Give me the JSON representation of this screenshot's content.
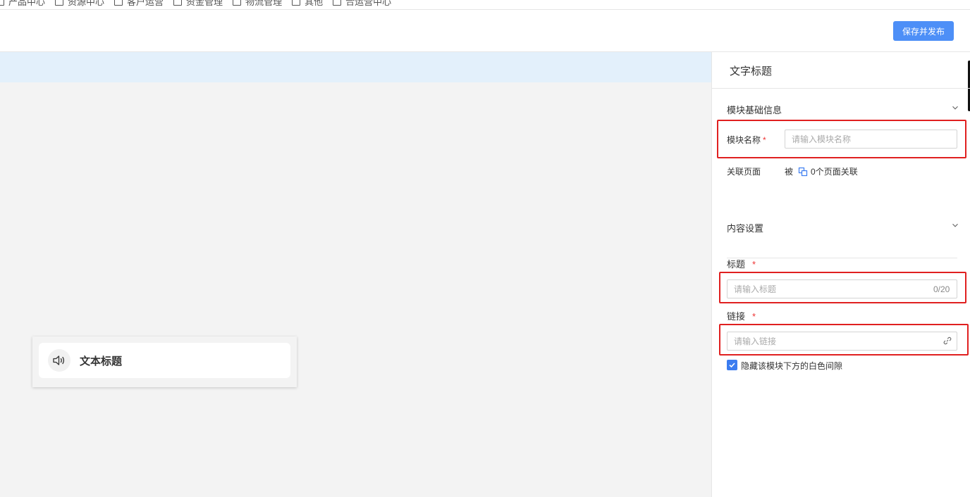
{
  "topnav": {
    "items": [
      "产品中心",
      "资源中心",
      "客户运营",
      "资金管理",
      "物流管理",
      "其他",
      "合运营中心"
    ]
  },
  "header": {
    "publish_button": "保存并发布"
  },
  "canvas": {
    "module_title": "文本标题",
    "module_icon": "speaker-icon"
  },
  "panel": {
    "title": "文字标题",
    "basic_section": {
      "heading": "模块基础信息",
      "name_label": "模块名称",
      "name_placeholder": "请输入模块名称",
      "assoc_label": "关联页面",
      "assoc_prefix": "被",
      "assoc_text": "0个页面关联"
    },
    "content_section": {
      "heading": "内容设置",
      "title_label": "标题",
      "title_placeholder": "请输入标题",
      "title_counter": "0/20",
      "link_label": "链接",
      "link_placeholder": "请输入链接",
      "hide_gap_label": "隐藏该模块下方的白色间隙",
      "hide_gap_checked": true
    },
    "required_mark": "*"
  },
  "colors": {
    "primary": "#4d8ff7",
    "highlight_box": "#e02020",
    "canvas_bg": "#f3f3f3",
    "canvas_strip": "#e3f0fb"
  }
}
